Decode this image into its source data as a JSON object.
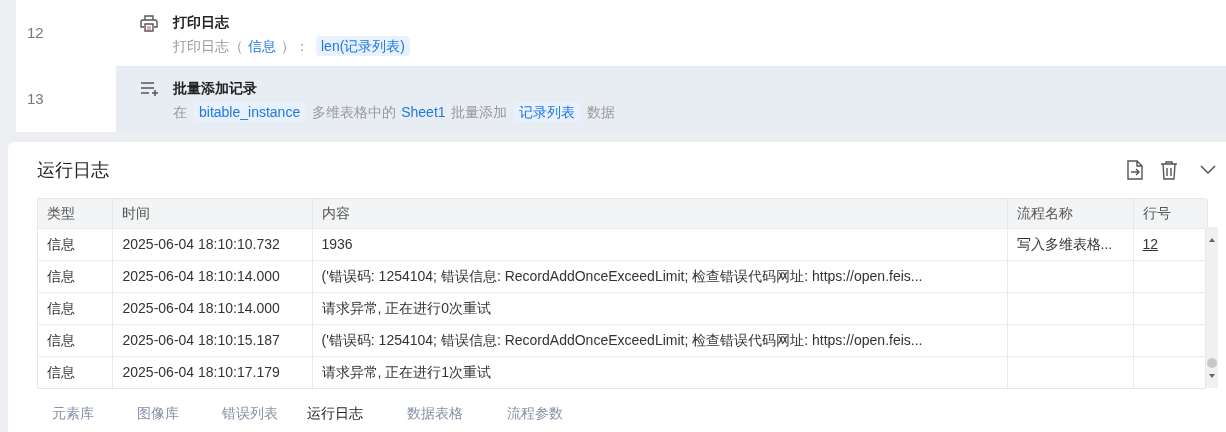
{
  "steps": [
    {
      "line": "12",
      "kind": "log",
      "title": "打印日志",
      "selected": false,
      "parts": [
        {
          "kind": "text",
          "text": "打印日志（"
        },
        {
          "kind": "value",
          "text": "信息"
        },
        {
          "kind": "text",
          "text": "）："
        },
        {
          "kind": "pill",
          "text": "len(记录列表)"
        }
      ]
    },
    {
      "line": "13",
      "kind": "batch",
      "title": "批量添加记录",
      "selected": true,
      "parts": [
        {
          "kind": "text",
          "text": "在"
        },
        {
          "kind": "pill",
          "text": "bitable_instance"
        },
        {
          "kind": "text",
          "text": "多维表格中的"
        },
        {
          "kind": "value",
          "text": "Sheet1"
        },
        {
          "kind": "text",
          "text": "批量添加"
        },
        {
          "kind": "pill",
          "text": "记录列表"
        },
        {
          "kind": "text",
          "text": "数据"
        }
      ]
    }
  ],
  "log_panel": {
    "title": "运行日志",
    "table": {
      "columns": [
        "类型",
        "时间",
        "内容",
        "流程名称",
        "行号"
      ],
      "rows": [
        [
          "信息",
          "2025-06-04 18:10:10.732",
          "1936",
          "写入多维表格...",
          "12"
        ],
        [
          "信息",
          "2025-06-04 18:10:14.000",
          "('错误码: 1254104; 错误信息: RecordAddOnceExceedLimit; 检查错误代码网址: https://open.feis...",
          "",
          ""
        ],
        [
          "信息",
          "2025-06-04 18:10:14.000",
          "请求异常, 正在进行0次重试",
          "",
          ""
        ],
        [
          "信息",
          "2025-06-04 18:10:15.187",
          "('错误码: 1254104; 错误信息: RecordAddOnceExceedLimit; 检查错误代码网址: https://open.feis...",
          "",
          ""
        ],
        [
          "信息",
          "2025-06-04 18:10:17.179",
          "请求异常, 正在进行1次重试",
          "",
          ""
        ]
      ]
    }
  },
  "bottom_tabs": [
    {
      "label": "元素库",
      "selected": false
    },
    {
      "label": "图像库",
      "selected": false
    },
    {
      "label": "错误列表",
      "selected": false
    },
    {
      "label": "运行日志",
      "selected": true
    },
    {
      "label": "数据表格",
      "selected": false
    },
    {
      "label": "流程参数",
      "selected": false
    }
  ]
}
